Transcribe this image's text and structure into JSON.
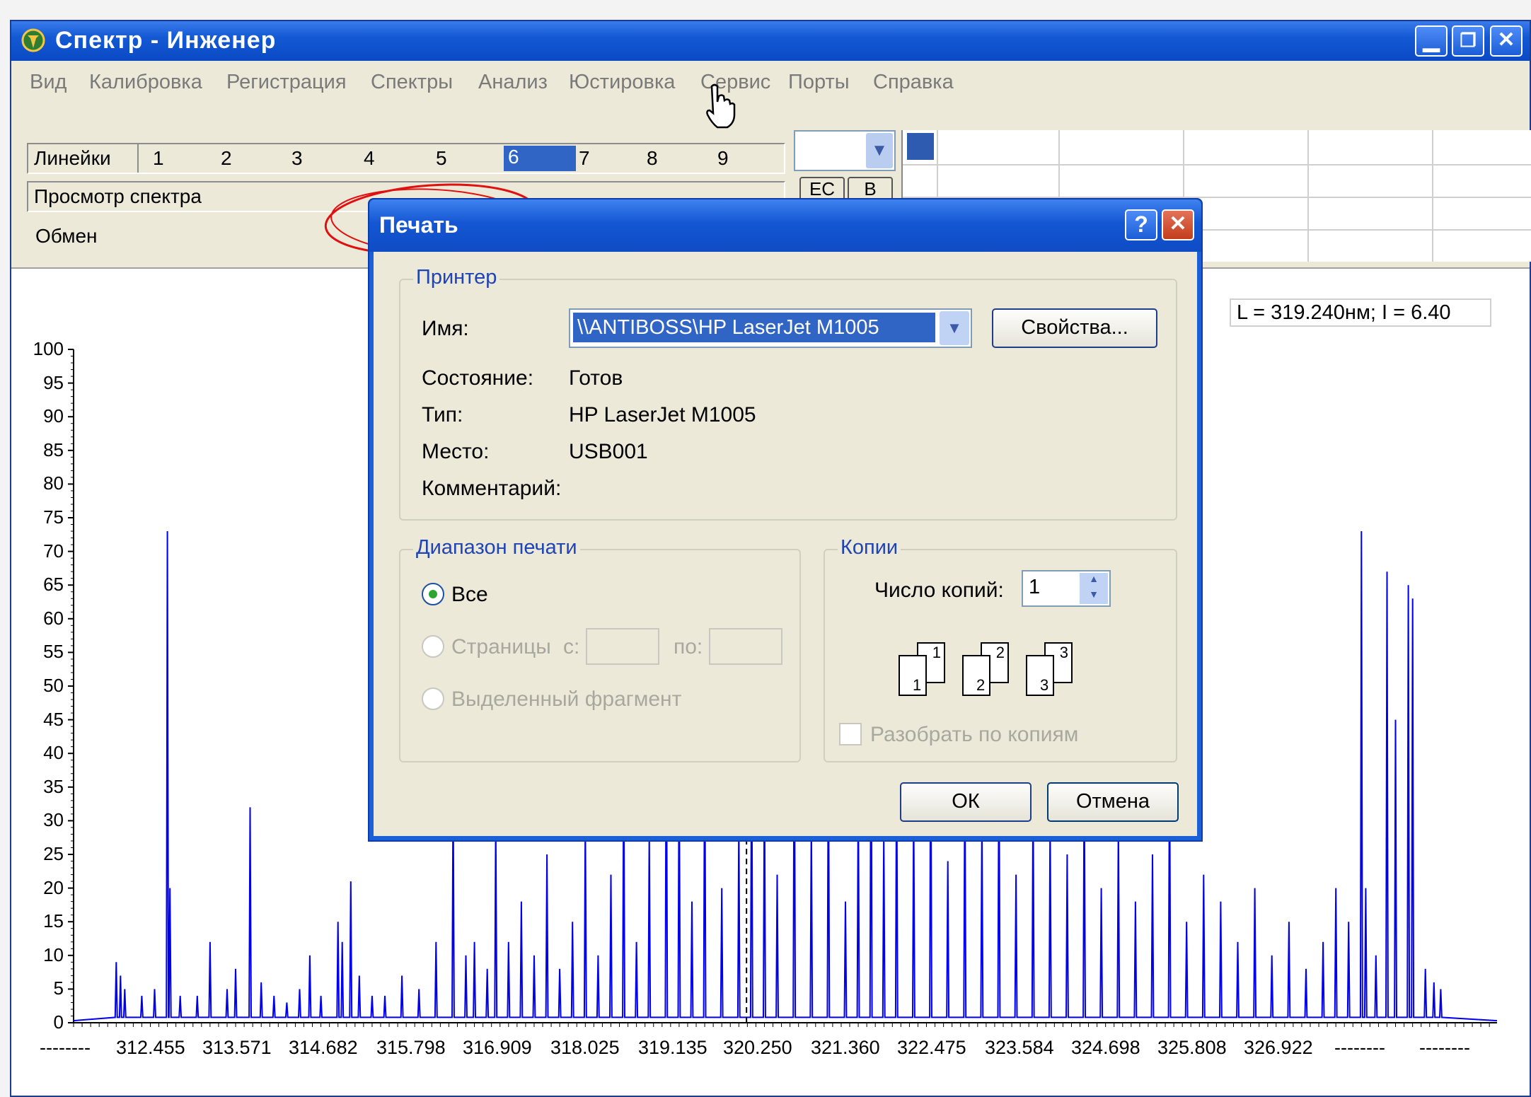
{
  "window": {
    "title": "Спектр - Инженер"
  },
  "menu": [
    "Вид",
    "Калибровка",
    "Регистрация",
    "Спектры",
    "Анализ",
    "Юстировка",
    "Сервис",
    "Порты",
    "Справка"
  ],
  "left_panel": {
    "lines_label": "Линейки",
    "lines": [
      "1",
      "2",
      "3",
      "4",
      "5",
      "6",
      "7",
      "8",
      "9"
    ],
    "selected_line": "6",
    "mode": "Просмотр спектра",
    "exchange": "Обмен"
  },
  "toolbar_buttons": [
    "ЕС",
    "В"
  ],
  "readout": "L = 319.240нм; I =  6.40",
  "dialog": {
    "title": "Печать",
    "printer": {
      "group": "Принтер",
      "name_label": "Имя:",
      "name_value": "\\\\ANTIBOSS\\HP LaserJet M1005",
      "properties_button": "Свойства...",
      "status_label": "Состояние:",
      "status_value": "Готов",
      "type_label": "Тип:",
      "type_value": "HP LaserJet M1005",
      "where_label": "Место:",
      "where_value": "USB001",
      "comment_label": "Комментарий:"
    },
    "range": {
      "group": "Диапазон печати",
      "all": "Все",
      "pages": "Страницы",
      "from": "с:",
      "to": "по:",
      "selection": "Выделенный фрагмент"
    },
    "copies": {
      "group": "Копии",
      "count_label": "Число копий:",
      "count_value": "1",
      "collate": "Разобрать по копиям",
      "collate_pages": [
        "1",
        "1",
        "2",
        "2",
        "3",
        "3"
      ]
    },
    "ok": "ОК",
    "cancel": "Отмена"
  },
  "chart_data": {
    "type": "line",
    "title": "",
    "xlabel": "",
    "ylabel": "",
    "y_ticks": [
      "100",
      "95",
      "90",
      "85",
      "80",
      "75",
      "70",
      "65",
      "60",
      "55",
      "50",
      "45",
      "40",
      "35",
      "30",
      "25",
      "20",
      "15",
      "10",
      "5",
      "0"
    ],
    "x_ticks": [
      "--------",
      "312.455",
      "313.571",
      "314.682",
      "315.798",
      "316.909",
      "318.025",
      "319.135",
      "320.250",
      "321.360",
      "322.475",
      "323.584",
      "324.698",
      "325.808",
      "326.922",
      "--------",
      "--------"
    ],
    "ylim": [
      0,
      100
    ],
    "xlim": [
      311.35,
      328.04
    ],
    "cursor_x": 319.24,
    "series": [
      {
        "color": "#0000ee",
        "peaks": [
          [
            311.85,
            9
          ],
          [
            311.9,
            7
          ],
          [
            311.95,
            5
          ],
          [
            312.15,
            4
          ],
          [
            312.3,
            5
          ],
          [
            312.45,
            73
          ],
          [
            312.48,
            20
          ],
          [
            312.6,
            4
          ],
          [
            312.8,
            4
          ],
          [
            312.95,
            12
          ],
          [
            313.15,
            5
          ],
          [
            313.25,
            8
          ],
          [
            313.42,
            32
          ],
          [
            313.55,
            6
          ],
          [
            313.7,
            4
          ],
          [
            313.85,
            3
          ],
          [
            314.0,
            5
          ],
          [
            314.12,
            10
          ],
          [
            314.25,
            4
          ],
          [
            314.45,
            15
          ],
          [
            314.5,
            12
          ],
          [
            314.6,
            21
          ],
          [
            314.7,
            7
          ],
          [
            314.85,
            4
          ],
          [
            315.0,
            4
          ],
          [
            315.2,
            7
          ],
          [
            315.4,
            5
          ],
          [
            315.6,
            12
          ],
          [
            315.8,
            35
          ],
          [
            315.95,
            10
          ],
          [
            316.05,
            12
          ],
          [
            316.2,
            8
          ],
          [
            316.3,
            30
          ],
          [
            316.45,
            12
          ],
          [
            316.6,
            18
          ],
          [
            316.75,
            10
          ],
          [
            316.9,
            25
          ],
          [
            317.05,
            8
          ],
          [
            317.2,
            15
          ],
          [
            317.35,
            30
          ],
          [
            317.5,
            10
          ],
          [
            317.65,
            22
          ],
          [
            317.8,
            40
          ],
          [
            317.95,
            12
          ],
          [
            318.1,
            28
          ],
          [
            318.3,
            50
          ],
          [
            318.45,
            40
          ],
          [
            318.6,
            18
          ],
          [
            318.75,
            45
          ],
          [
            318.95,
            20
          ],
          [
            319.15,
            30
          ],
          [
            319.3,
            45
          ],
          [
            319.45,
            38
          ],
          [
            319.6,
            22
          ],
          [
            319.8,
            50
          ],
          [
            320.0,
            30
          ],
          [
            320.2,
            42
          ],
          [
            320.4,
            18
          ],
          [
            320.55,
            35
          ],
          [
            320.7,
            50
          ],
          [
            320.85,
            28
          ],
          [
            321.0,
            40
          ],
          [
            321.2,
            32
          ],
          [
            321.4,
            45
          ],
          [
            321.6,
            24
          ],
          [
            321.8,
            38
          ],
          [
            322.0,
            30
          ],
          [
            322.2,
            42
          ],
          [
            322.4,
            22
          ],
          [
            322.6,
            35
          ],
          [
            322.8,
            30
          ],
          [
            323.0,
            25
          ],
          [
            323.2,
            38
          ],
          [
            323.4,
            20
          ],
          [
            323.6,
            30
          ],
          [
            323.8,
            18
          ],
          [
            324.0,
            25
          ],
          [
            324.2,
            40
          ],
          [
            324.4,
            15
          ],
          [
            324.6,
            22
          ],
          [
            324.8,
            18
          ],
          [
            325.0,
            12
          ],
          [
            325.2,
            20
          ],
          [
            325.4,
            10
          ],
          [
            325.6,
            15
          ],
          [
            325.8,
            8
          ],
          [
            326.0,
            12
          ],
          [
            326.15,
            20
          ],
          [
            326.3,
            15
          ],
          [
            326.45,
            73
          ],
          [
            326.5,
            20
          ],
          [
            326.62,
            10
          ],
          [
            326.75,
            67
          ],
          [
            326.85,
            45
          ],
          [
            327.0,
            65
          ],
          [
            327.05,
            63
          ],
          [
            327.2,
            8
          ],
          [
            327.3,
            6
          ],
          [
            327.38,
            5
          ]
        ]
      }
    ]
  }
}
